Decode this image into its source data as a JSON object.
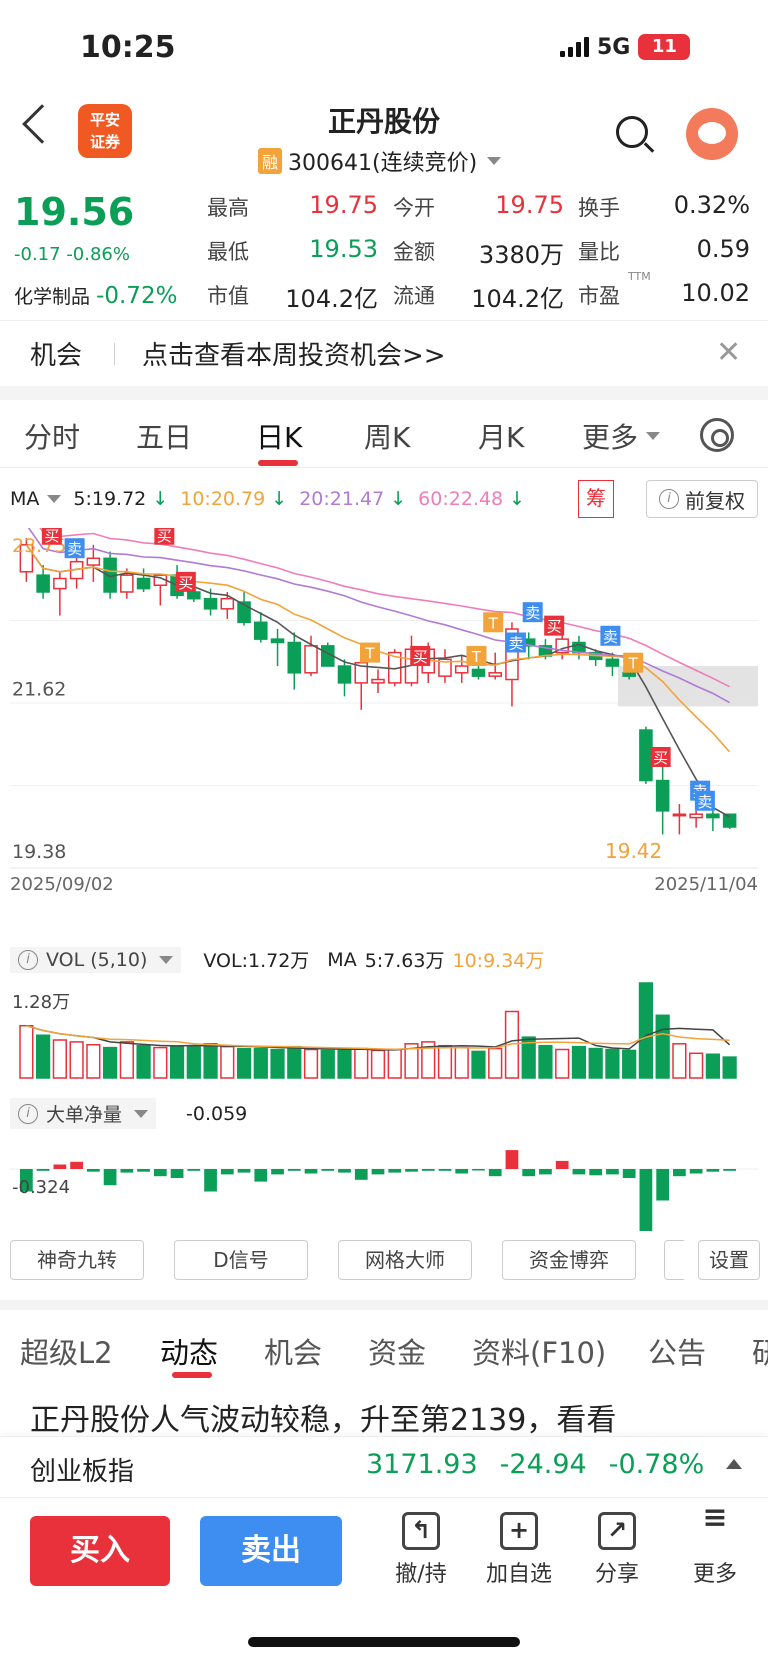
{
  "status": {
    "time": "10:25",
    "network": "5G",
    "battery": "11"
  },
  "header": {
    "broker_logo": "平安\n证券",
    "title": "正丹股份",
    "badge": "融",
    "code": "300641(连续竞价)"
  },
  "quote": {
    "price": "19.56",
    "change": "-0.17",
    "change_pct": "-0.86%",
    "sector_name": "化学制品",
    "sector_pct": "-0.72%",
    "high_label": "最高",
    "high": "19.75",
    "open_label": "今开",
    "open": "19.75",
    "turnover_label": "换手",
    "turnover": "0.32%",
    "low_label": "最低",
    "low": "19.53",
    "amount_label": "金额",
    "amount": "3380万",
    "vol_ratio_label": "量比",
    "vol_ratio": "0.59",
    "mcap_label": "市值",
    "mcap": "104.2亿",
    "float_label": "流通",
    "float_cap": "104.2亿",
    "pe_label": "市盈",
    "pe_sup": "TTM",
    "pe": "10.02"
  },
  "banner": {
    "label": "机会",
    "text": "点击查看本周投资机会>>"
  },
  "chart_tabs": [
    "分时",
    "五日",
    "日K",
    "周K",
    "月K",
    "更多"
  ],
  "active_chart_tab": "日K",
  "ma_legend": {
    "ma_label": "MA",
    "ma5": "5:19.72",
    "ma10": "10:20.79",
    "ma20": "20:21.47",
    "ma60": "60:22.48",
    "chou": "筹",
    "fuquan": "前复权"
  },
  "colors": {
    "up": "#e8313b",
    "down": "#0a9e57",
    "ma5": "#555555",
    "ma10": "#f2a33a",
    "ma20": "#b07ad6",
    "ma60": "#f07dba"
  },
  "chart_data": {
    "type": "candlestick",
    "y_labels": [
      "23.75",
      "21.62",
      "19.38"
    ],
    "ylim": [
      19.1,
      24.0
    ],
    "low_marker": "19.42",
    "dates": [
      "2025/09/02",
      "2025/11/04"
    ],
    "signal_marks": [
      "买",
      "卖",
      "买",
      "买",
      "T",
      "卖",
      "买",
      "卖",
      "T",
      "买",
      "T",
      "卖",
      "T",
      "买",
      "卖",
      "卖"
    ],
    "ohlc": [
      [
        23.35,
        23.85,
        23.2,
        23.75
      ],
      [
        23.3,
        23.45,
        22.95,
        23.05
      ],
      [
        23.1,
        23.35,
        22.7,
        23.25
      ],
      [
        23.25,
        23.65,
        23.1,
        23.5
      ],
      [
        23.45,
        23.75,
        23.2,
        23.55
      ],
      [
        23.55,
        23.65,
        22.95,
        23.05
      ],
      [
        23.05,
        23.4,
        22.95,
        23.3
      ],
      [
        23.25,
        23.4,
        23.05,
        23.1
      ],
      [
        23.15,
        23.3,
        22.85,
        23.3
      ],
      [
        23.3,
        23.45,
        22.95,
        23.0
      ],
      [
        23.05,
        23.15,
        22.9,
        22.95
      ],
      [
        22.95,
        23.1,
        22.7,
        22.8
      ],
      [
        22.8,
        23.05,
        22.65,
        22.95
      ],
      [
        22.9,
        23.05,
        22.55,
        22.6
      ],
      [
        22.6,
        22.75,
        22.3,
        22.35
      ],
      [
        22.35,
        22.5,
        21.95,
        22.3
      ],
      [
        22.3,
        22.45,
        21.6,
        21.85
      ],
      [
        21.85,
        22.4,
        21.8,
        22.25
      ],
      [
        22.25,
        22.3,
        21.95,
        21.95
      ],
      [
        21.95,
        22.05,
        21.5,
        21.7
      ],
      [
        21.7,
        22.05,
        21.3,
        22.0
      ],
      [
        21.7,
        21.9,
        21.55,
        21.75
      ],
      [
        21.7,
        22.2,
        21.65,
        22.15
      ],
      [
        21.7,
        22.4,
        21.65,
        22.2
      ],
      [
        21.85,
        22.3,
        21.7,
        22.2
      ],
      [
        21.8,
        22.2,
        21.7,
        22.05
      ],
      [
        21.85,
        22.1,
        21.7,
        21.95
      ],
      [
        21.9,
        22.05,
        21.75,
        21.8
      ],
      [
        21.8,
        22.15,
        21.75,
        21.85
      ],
      [
        21.75,
        22.6,
        21.35,
        22.5
      ],
      [
        22.35,
        22.45,
        22.05,
        22.25
      ],
      [
        22.25,
        22.35,
        22.05,
        22.1
      ],
      [
        22.15,
        22.45,
        22.05,
        22.35
      ],
      [
        22.3,
        22.4,
        22.05,
        22.15
      ],
      [
        22.15,
        22.2,
        21.95,
        22.05
      ],
      [
        22.05,
        22.15,
        21.8,
        21.95
      ],
      [
        21.85,
        21.95,
        21.75,
        21.8
      ],
      [
        21.0,
        21.05,
        20.2,
        20.25
      ],
      [
        20.25,
        20.6,
        19.45,
        19.8
      ],
      [
        19.75,
        19.9,
        19.45,
        19.75
      ],
      [
        19.7,
        19.8,
        19.55,
        19.75
      ],
      [
        19.75,
        19.85,
        19.5,
        19.7
      ],
      [
        19.75,
        19.75,
        19.53,
        19.56
      ]
    ]
  },
  "volume": {
    "label": "VOL (5,10)",
    "vol": "VOL:1.72万",
    "ma_label": "MA",
    "ma5": "5:7.63万",
    "ma10": "10:9.34万",
    "y_label": "1.28万"
  },
  "big_order": {
    "label": "大单净量",
    "value": "-0.059",
    "y_label": "-0.324"
  },
  "indicator_buttons": [
    "神奇九转",
    "D信号",
    "网格大师",
    "资金博弈",
    "设置"
  ],
  "section_tabs": [
    "超级L2",
    "动态",
    "机会",
    "资金",
    "资料(F10)",
    "公告",
    "研"
  ],
  "active_section_tab": "动态",
  "news_headline": "正丹股份人气波动较稳，升至第2139，看看",
  "index": {
    "name": "创业板指",
    "value": "3171.93",
    "change": "-24.94",
    "pct": "-0.78%"
  },
  "actions": {
    "buy": "买入",
    "sell": "卖出",
    "cancel": "撤/持",
    "add": "加自选",
    "share": "分享",
    "more": "更多"
  }
}
